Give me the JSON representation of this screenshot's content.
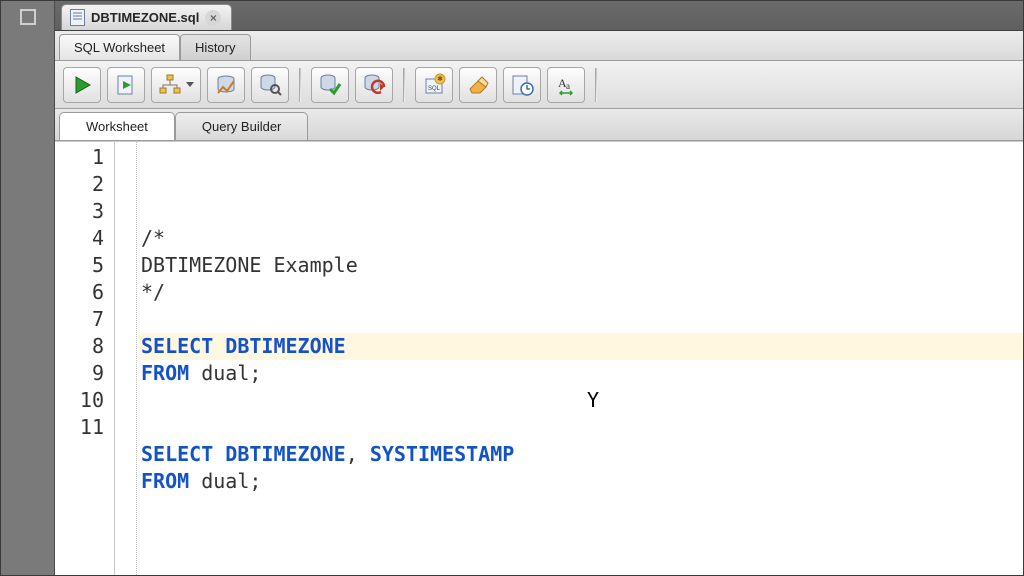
{
  "fileTab": {
    "name": "DBTIMEZONE.sql"
  },
  "subTabs": {
    "worksheet": "SQL Worksheet",
    "history": "History"
  },
  "toolbar": {
    "run": "run-statement",
    "runScript": "run-script",
    "explain": "explain-plan",
    "autotrace": "autotrace",
    "sqltune": "sql-tuning",
    "commit": "commit",
    "rollback": "rollback",
    "unshared": "unshared-worksheet",
    "clear": "clear",
    "history": "sql-history",
    "format": "format"
  },
  "editorTabs": {
    "worksheet": "Worksheet",
    "queryBuilder": "Query Builder"
  },
  "code": {
    "lines": [
      {
        "n": 1,
        "tokens": [
          {
            "t": "/*",
            "c": "cm"
          }
        ]
      },
      {
        "n": 2,
        "tokens": [
          {
            "t": "DBTIMEZONE Example",
            "c": "cm"
          }
        ]
      },
      {
        "n": 3,
        "tokens": [
          {
            "t": "*/",
            "c": "cm"
          }
        ]
      },
      {
        "n": 4,
        "tokens": []
      },
      {
        "n": 5,
        "hl": true,
        "tokens": [
          {
            "t": "SELECT",
            "c": "kw"
          },
          {
            "t": " "
          },
          {
            "t": "DBTIMEZONE",
            "c": "kw"
          }
        ]
      },
      {
        "n": 6,
        "tokens": [
          {
            "t": "FROM",
            "c": "kw"
          },
          {
            "t": " dual;"
          }
        ]
      },
      {
        "n": 7,
        "tokens": []
      },
      {
        "n": 8,
        "tokens": []
      },
      {
        "n": 9,
        "tokens": [
          {
            "t": "SELECT",
            "c": "kw"
          },
          {
            "t": " "
          },
          {
            "t": "DBTIMEZONE",
            "c": "kw"
          },
          {
            "t": ", "
          },
          {
            "t": "SYSTIMESTAMP",
            "c": "kw"
          }
        ]
      },
      {
        "n": 10,
        "tokens": [
          {
            "t": "FROM",
            "c": "kw"
          },
          {
            "t": " dual;"
          }
        ]
      },
      {
        "n": 11,
        "tokens": []
      }
    ],
    "cursorGlyph": "Y"
  }
}
